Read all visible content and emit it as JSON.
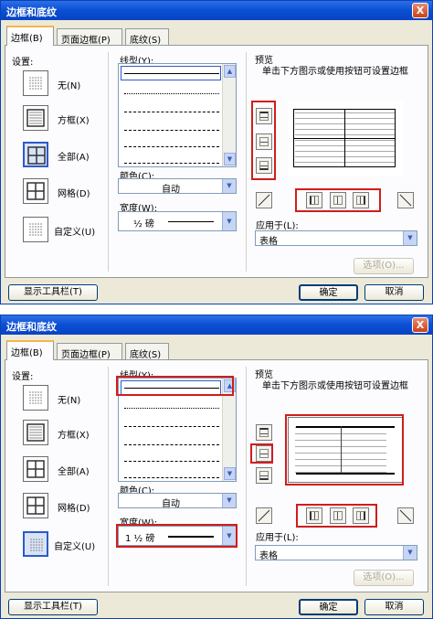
{
  "dialogs": [
    {
      "title": "边框和底纹",
      "close_glyph": "X",
      "tabs": [
        "边框(B)",
        "页面边框(P)",
        "底纹(S)"
      ],
      "settings_label": "设置:",
      "settings": [
        "无(N)",
        "方框(X)",
        "全部(A)",
        "网格(D)",
        "自定义(U)"
      ],
      "selected_setting": "全部(A)",
      "style_label": "线型(Y):",
      "selected_style": "single solid line",
      "color_label": "颜色(C):",
      "color_value": "自动",
      "width_label": "宽度(W):",
      "width_value": "½ 磅",
      "preview_label": "预览",
      "preview_hint": "单击下方图示或使用按钮可设置边框",
      "apply_label": "应用于(L):",
      "apply_value": "表格",
      "options_button": "选项(O)...",
      "toolbar_button": "显示工具栏(T)",
      "ok_button": "确定",
      "cancel_button": "取消"
    },
    {
      "title": "边框和底纹",
      "close_glyph": "X",
      "tabs": [
        "边框(B)",
        "页面边框(P)",
        "底纹(S)"
      ],
      "settings_label": "设置:",
      "settings": [
        "无(N)",
        "方框(X)",
        "全部(A)",
        "网格(D)",
        "自定义(U)"
      ],
      "selected_setting": "自定义(U)",
      "style_label": "线型(Y):",
      "selected_style": "single solid line",
      "color_label": "颜色(C):",
      "color_value": "自动",
      "width_label": "宽度(W):",
      "width_value": "1 ½ 磅",
      "preview_label": "预览",
      "preview_hint": "单击下方图示或使用按钮可设置边框",
      "apply_label": "应用于(L):",
      "apply_value": "表格",
      "options_button": "选项(O)...",
      "toolbar_button": "显示工具栏(T)",
      "ok_button": "确定",
      "cancel_button": "取消"
    }
  ],
  "colors": {
    "titlebar": "#0a4fd3",
    "dialog_bg": "#ece9d8",
    "selection": "#2d5bc6",
    "highlight_box": "#d01d1d"
  }
}
